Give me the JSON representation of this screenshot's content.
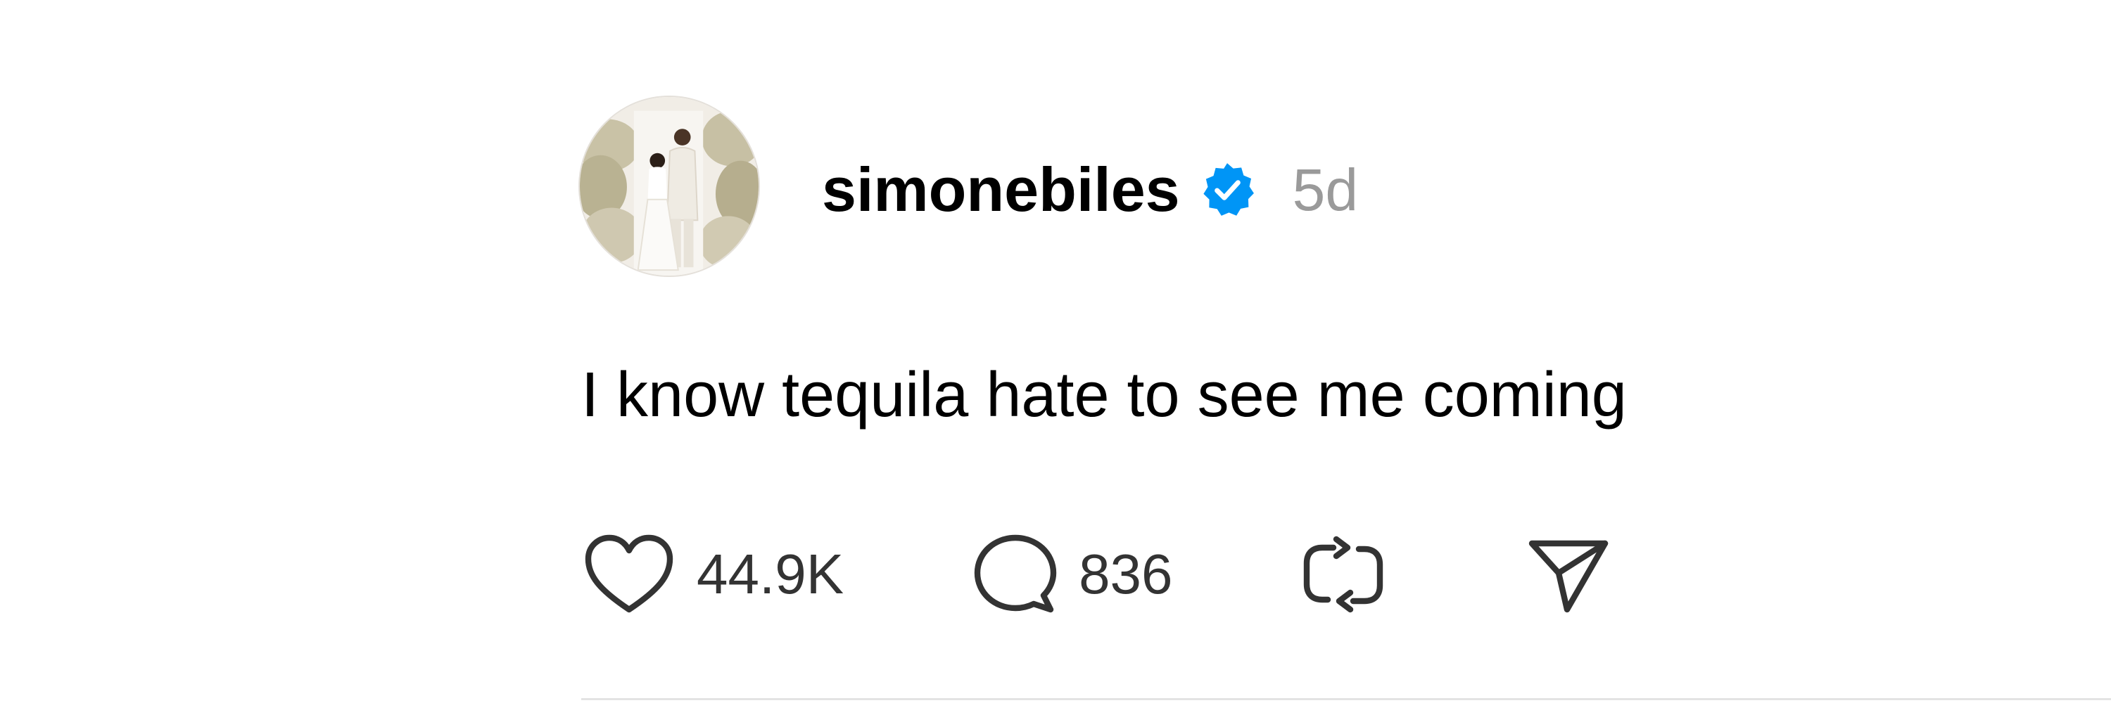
{
  "post": {
    "author": {
      "username": "simonebiles",
      "verified": true,
      "avatar_icon": "wedding-photo-avatar"
    },
    "timestamp": "5d",
    "text": "I know tequila hate to see me coming",
    "actions": {
      "likes": "44.9K",
      "comments": "836"
    }
  },
  "icons": {
    "like": "heart-icon",
    "comment": "speech-bubble-icon",
    "repost": "repost-icon",
    "share": "paper-plane-icon",
    "verified": "verified-badge-icon"
  },
  "colors": {
    "text": "#000000",
    "muted": "#9a9a9a",
    "verified_badge": "#0095f6",
    "icon_stroke": "#333333"
  }
}
